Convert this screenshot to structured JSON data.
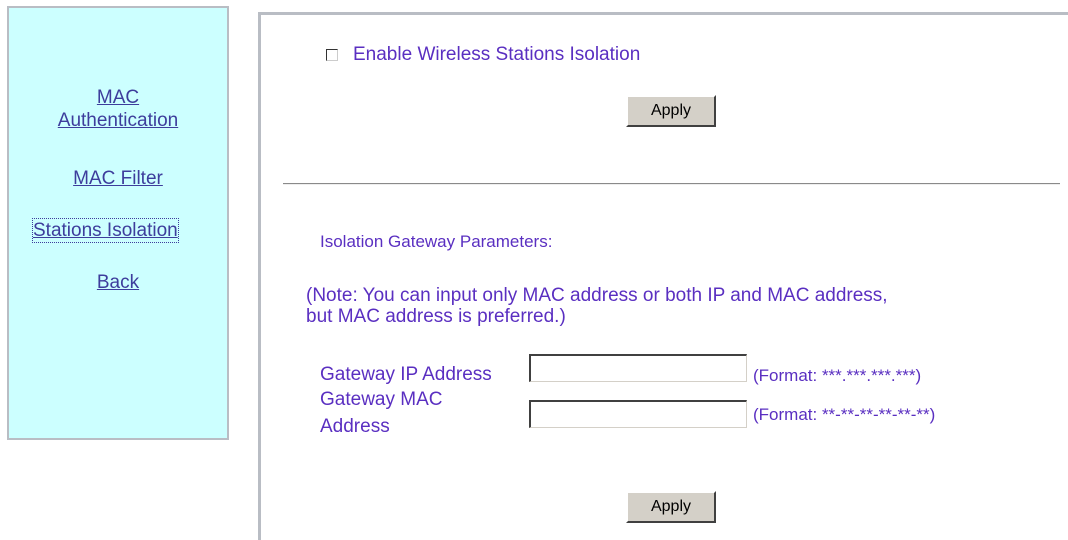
{
  "nav": {
    "items": [
      {
        "label_line1": "MAC",
        "label_line2": "Authentication"
      },
      {
        "label": "MAC Filter"
      },
      {
        "label": "Stations Isolation"
      },
      {
        "label": "Back"
      }
    ]
  },
  "isolation": {
    "checkbox_label": "Enable Wireless Stations Isolation",
    "checked": false,
    "apply_label": "Apply"
  },
  "gateway": {
    "heading": "Isolation Gateway Parameters:",
    "note_line1": "(Note: You can input only MAC address or both IP and MAC address,",
    "note_line2": "but MAC address is preferred.)",
    "ip_label": "Gateway IP Address",
    "ip_value": "",
    "ip_format": "(Format: ***.***.***.***)",
    "mac_label_line1": "Gateway MAC",
    "mac_label_line2": "Address",
    "mac_value": "",
    "mac_format": "(Format: **-**-**-**-**-**)",
    "apply_label": "Apply"
  },
  "colors": {
    "nav_background": "#ccffff",
    "link": "#3d3d9c",
    "text": "#5a2fc1",
    "button_face": "#d4d0c8"
  }
}
